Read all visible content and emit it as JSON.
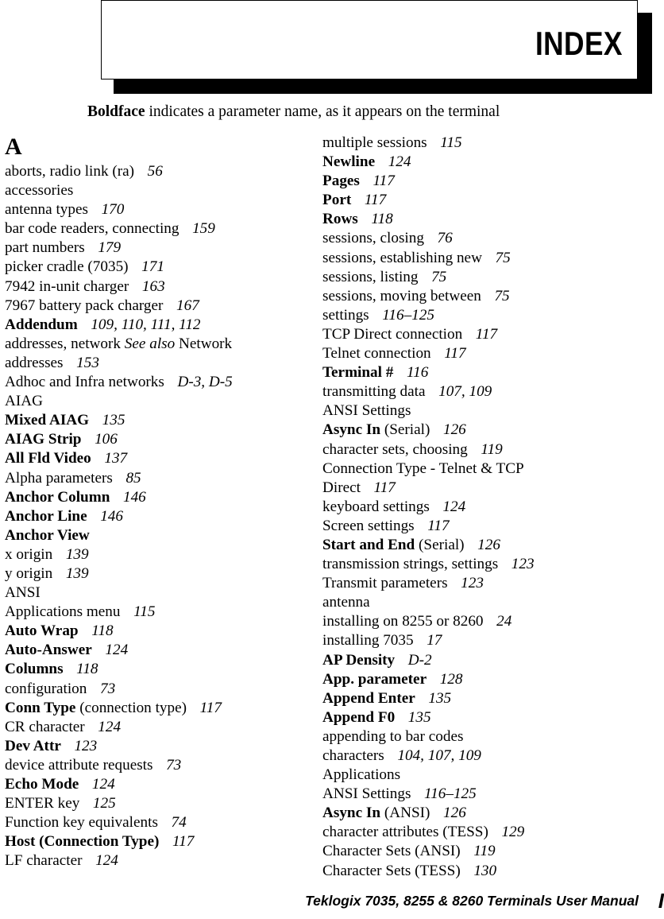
{
  "header": {
    "title": "Index"
  },
  "note": {
    "bold_word": "Boldface",
    "rest": " indicates a parameter name, as it appears on the terminal"
  },
  "letter_heading": "A",
  "columns": {
    "left": [
      {
        "level": 0,
        "text": "aborts, radio link (ra)",
        "pages": "56"
      },
      {
        "level": 0,
        "text": "accessories",
        "pages": ""
      },
      {
        "level": 1,
        "text": "antenna types",
        "pages": "170"
      },
      {
        "level": 1,
        "text": "bar code readers, connecting",
        "pages": "159"
      },
      {
        "level": 1,
        "text": "part numbers",
        "pages": "179"
      },
      {
        "level": 1,
        "text": "picker cradle (7035)",
        "pages": "171"
      },
      {
        "level": 1,
        "text": "7942 in-unit charger",
        "pages": "163"
      },
      {
        "level": 1,
        "text": "7967 battery pack charger",
        "pages": "167"
      },
      {
        "level": 0,
        "text": "Addendum",
        "bold": true,
        "pages": "109, 110, 111, 112"
      },
      {
        "level": 0,
        "text": "addresses, network ",
        "see_also": "See also",
        "text_after": " Network",
        "pages": ""
      },
      {
        "level": 0,
        "continued": true,
        "text": "addresses",
        "pages": "153"
      },
      {
        "level": 0,
        "text": "Adhoc and Infra networks",
        "pages": "D-3, D-5"
      },
      {
        "level": 0,
        "text": "AIAG",
        "pages": ""
      },
      {
        "level": 1,
        "text": "Mixed AIAG",
        "bold": true,
        "pages": "135"
      },
      {
        "level": 0,
        "text": "AIAG Strip",
        "bold": true,
        "pages": "106"
      },
      {
        "level": 0,
        "text": "All Fld Video",
        "bold": true,
        "pages": "137"
      },
      {
        "level": 0,
        "text": "Alpha parameters",
        "pages": "85"
      },
      {
        "level": 0,
        "text": "Anchor Column",
        "bold": true,
        "pages": "146"
      },
      {
        "level": 0,
        "text": "Anchor Line",
        "bold": true,
        "pages": "146"
      },
      {
        "level": 0,
        "text": "Anchor View",
        "bold": true,
        "pages": ""
      },
      {
        "level": 1,
        "text": "x origin",
        "pages": "139"
      },
      {
        "level": 1,
        "text": "y origin",
        "pages": "139"
      },
      {
        "level": 0,
        "text": "ANSI",
        "pages": ""
      },
      {
        "level": 1,
        "text": "Applications menu",
        "pages": "115"
      },
      {
        "level": 1,
        "text": "Auto Wrap",
        "bold": true,
        "pages": "118"
      },
      {
        "level": 1,
        "text": "Auto-Answer",
        "bold": true,
        "pages": "124"
      },
      {
        "level": 1,
        "text": "Columns",
        "bold": true,
        "pages": "118"
      },
      {
        "level": 1,
        "text": "configuration",
        "pages": "73"
      },
      {
        "level": 1,
        "text": "Conn Type",
        "bold": true,
        "text_after": " (connection type)",
        "pages": "117"
      },
      {
        "level": 1,
        "text": "CR character",
        "pages": "124"
      },
      {
        "level": 1,
        "text": "Dev Attr",
        "bold": true,
        "pages": "123"
      },
      {
        "level": 1,
        "text": "device attribute requests",
        "pages": "73"
      },
      {
        "level": 1,
        "text": "Echo Mode",
        "bold": true,
        "pages": "124"
      },
      {
        "level": 1,
        "text": "ENTER key",
        "pages": "125"
      },
      {
        "level": 1,
        "text": "Function key equivalents",
        "pages": "74"
      },
      {
        "level": 1,
        "text": "Host (Connection Type)",
        "bold": true,
        "pages": "117"
      },
      {
        "level": 1,
        "text": "LF character",
        "pages": "124"
      }
    ],
    "right": [
      {
        "level": 1,
        "text": "multiple sessions",
        "pages": "115"
      },
      {
        "level": 1,
        "text": "Newline",
        "bold": true,
        "pages": "124"
      },
      {
        "level": 1,
        "text": "Pages",
        "bold": true,
        "pages": "117"
      },
      {
        "level": 1,
        "text": "Port",
        "bold": true,
        "pages": "117"
      },
      {
        "level": 1,
        "text": "Rows",
        "bold": true,
        "pages": "118"
      },
      {
        "level": 1,
        "text": "sessions, closing",
        "pages": "76"
      },
      {
        "level": 1,
        "text": "sessions, establishing new",
        "pages": "75"
      },
      {
        "level": 1,
        "text": "sessions, listing",
        "pages": "75"
      },
      {
        "level": 1,
        "text": "sessions, moving between",
        "pages": "75"
      },
      {
        "level": 1,
        "text": "settings",
        "pages": "116–125"
      },
      {
        "level": 1,
        "text": "TCP Direct connection",
        "pages": "117"
      },
      {
        "level": 1,
        "text": "Telnet connection",
        "pages": "117"
      },
      {
        "level": 1,
        "text": "Terminal #",
        "bold": true,
        "pages": "116"
      },
      {
        "level": 1,
        "text": "transmitting data",
        "pages": "107, 109"
      },
      {
        "level": 0,
        "text": "ANSI Settings",
        "pages": ""
      },
      {
        "level": 1,
        "text": "Async In",
        "bold": true,
        "text_after": " (Serial)",
        "pages": "126"
      },
      {
        "level": 1,
        "text": "character sets, choosing",
        "pages": "119"
      },
      {
        "level": 1,
        "text": "Connection Type - Telnet & TCP",
        "pages": ""
      },
      {
        "level": 2,
        "text": "Direct",
        "pages": "117"
      },
      {
        "level": 1,
        "text": "keyboard settings",
        "pages": "124"
      },
      {
        "level": 1,
        "text": "Screen settings",
        "pages": "117"
      },
      {
        "level": 1,
        "text": "Start and End",
        "bold": true,
        "text_after": " (Serial)",
        "pages": "126"
      },
      {
        "level": 1,
        "text": "transmission strings, settings",
        "pages": "123"
      },
      {
        "level": 1,
        "text": "Transmit parameters",
        "pages": "123"
      },
      {
        "level": 0,
        "text": "antenna",
        "pages": ""
      },
      {
        "level": 1,
        "text": "installing on 8255 or 8260",
        "pages": "24"
      },
      {
        "level": 1,
        "text": "installing 7035",
        "pages": "17"
      },
      {
        "level": 0,
        "text": "AP Density",
        "bold": true,
        "pages": "D-2"
      },
      {
        "level": 0,
        "text": "App. parameter",
        "bold": true,
        "pages": "128"
      },
      {
        "level": 0,
        "text": "Append Enter",
        "bold": true,
        "pages": "135"
      },
      {
        "level": 0,
        "text": "Append F0",
        "bold": true,
        "pages": "135"
      },
      {
        "level": 0,
        "text": "appending to bar codes",
        "pages": ""
      },
      {
        "level": 1,
        "text": "characters",
        "pages": "104, 107, 109"
      },
      {
        "level": 0,
        "text": "Applications",
        "pages": ""
      },
      {
        "level": 1,
        "text": "ANSI Settings",
        "pages": "116–125"
      },
      {
        "level": 1,
        "text": "Async In",
        "bold": true,
        "text_after": "  (ANSI)",
        "pages": "126"
      },
      {
        "level": 1,
        "text": "character attributes (TESS)",
        "pages": "129"
      },
      {
        "level": 1,
        "text": "Character Sets (ANSI)",
        "pages": "119"
      },
      {
        "level": 1,
        "text": "Character Sets (TESS)",
        "pages": "130"
      }
    ]
  },
  "footer": {
    "manual_title": "Teklogix 7035, 8255 & 8260 Terminals User Manual",
    "page_number": "I"
  }
}
